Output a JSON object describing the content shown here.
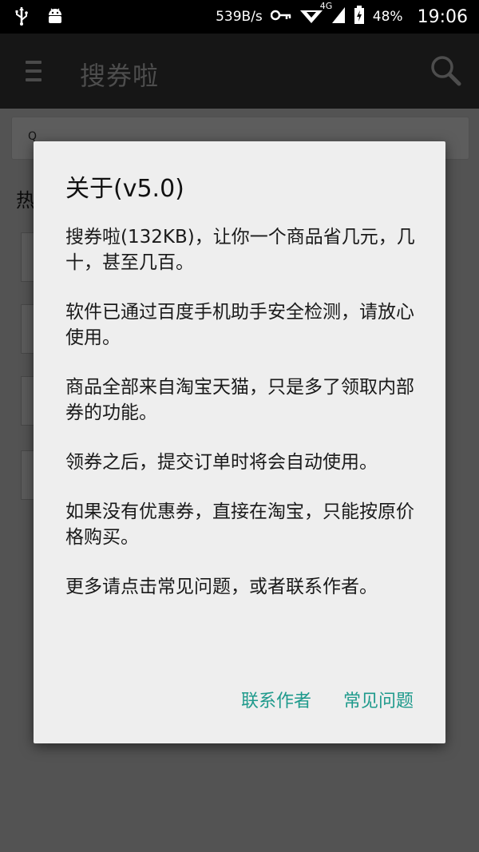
{
  "status_bar": {
    "net_speed": "539B/s",
    "network": "4G",
    "battery": "48%",
    "time": "19:06",
    "icons": [
      "usb-icon",
      "android-icon",
      "key-icon",
      "signal-icon",
      "battery-icon"
    ]
  },
  "app_bar": {
    "title": "搜券啦",
    "menu_icon": "hamburger-icon",
    "search_icon": "search-icon"
  },
  "background": {
    "search_prefix": "Q",
    "hot_label": "热"
  },
  "dialog": {
    "title": "关于(v5.0)",
    "paragraphs": [
      "搜券啦(132KB)，让你一个商品省几元，几十，甚至几百。",
      "软件已通过百度手机助手安全检测，请放心使用。",
      "商品全部来自淘宝天猫，只是多了领取内部券的功能。",
      "领券之后，提交订单时将会自动使用。",
      "如果没有优惠券，直接在淘宝，只能按原价格购买。",
      "更多请点击常见问题，或者联系作者。"
    ],
    "buttons": {
      "contact": "联系作者",
      "faq": "常见问题"
    }
  },
  "colors": {
    "accent": "#1e9a8c",
    "dialog_bg": "#eeeeee",
    "app_bar_bg": "#161616"
  }
}
